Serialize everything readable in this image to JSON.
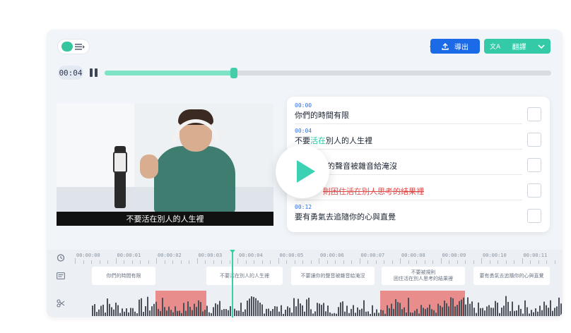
{
  "toolbar": {
    "export_label": "導出",
    "translate_label": "翻譯",
    "icons": [
      "gear-icon",
      "book-icon",
      "thermometer-icon",
      "upload-icon",
      "translate-icon",
      "chevron-down-icon"
    ]
  },
  "player": {
    "current_time": "00:04",
    "progress": 0.29,
    "caption": "不要活在別人的人生裡"
  },
  "subtitles": [
    {
      "time": "00:00",
      "text": "你們的時間有限"
    },
    {
      "time": "00:04",
      "text_pre": "不要",
      "text_hl": "活在",
      "text_post": "別人的人生裡"
    },
    {
      "time": "",
      "text": "的聲音被雜音給淹沒"
    },
    {
      "time": "",
      "text": "則困住活在別人思考的結果裡"
    },
    {
      "time": "00:12",
      "text": "要有勇氣去追隨你的心與直覺"
    }
  ],
  "timeline": {
    "ruler": [
      "00:00:00",
      "00:00:01",
      "00:00:02",
      "00:00:03",
      "00:00:04",
      "00:00:05",
      "00:00:06",
      "00:00:07",
      "00:00:08",
      "00:00:09",
      "00:00:10",
      "00:00:11"
    ],
    "clips": [
      {
        "line1": "你們的時間有限",
        "line2": ""
      },
      {
        "line1": "不要活在別人的人生裡",
        "line2": ""
      },
      {
        "line1": "不要讓你的聲音被雜音給淹沒",
        "line2": ""
      },
      {
        "line1": "不要被規則",
        "line2": "困住活在別人思考的結果裡"
      },
      {
        "line1": "要有勇氣去追隨你的心與直覺",
        "line2": ""
      }
    ],
    "colors": {
      "accent": "#36cfa9",
      "cut": "#e88c8c",
      "primary": "#1b6be8"
    }
  }
}
